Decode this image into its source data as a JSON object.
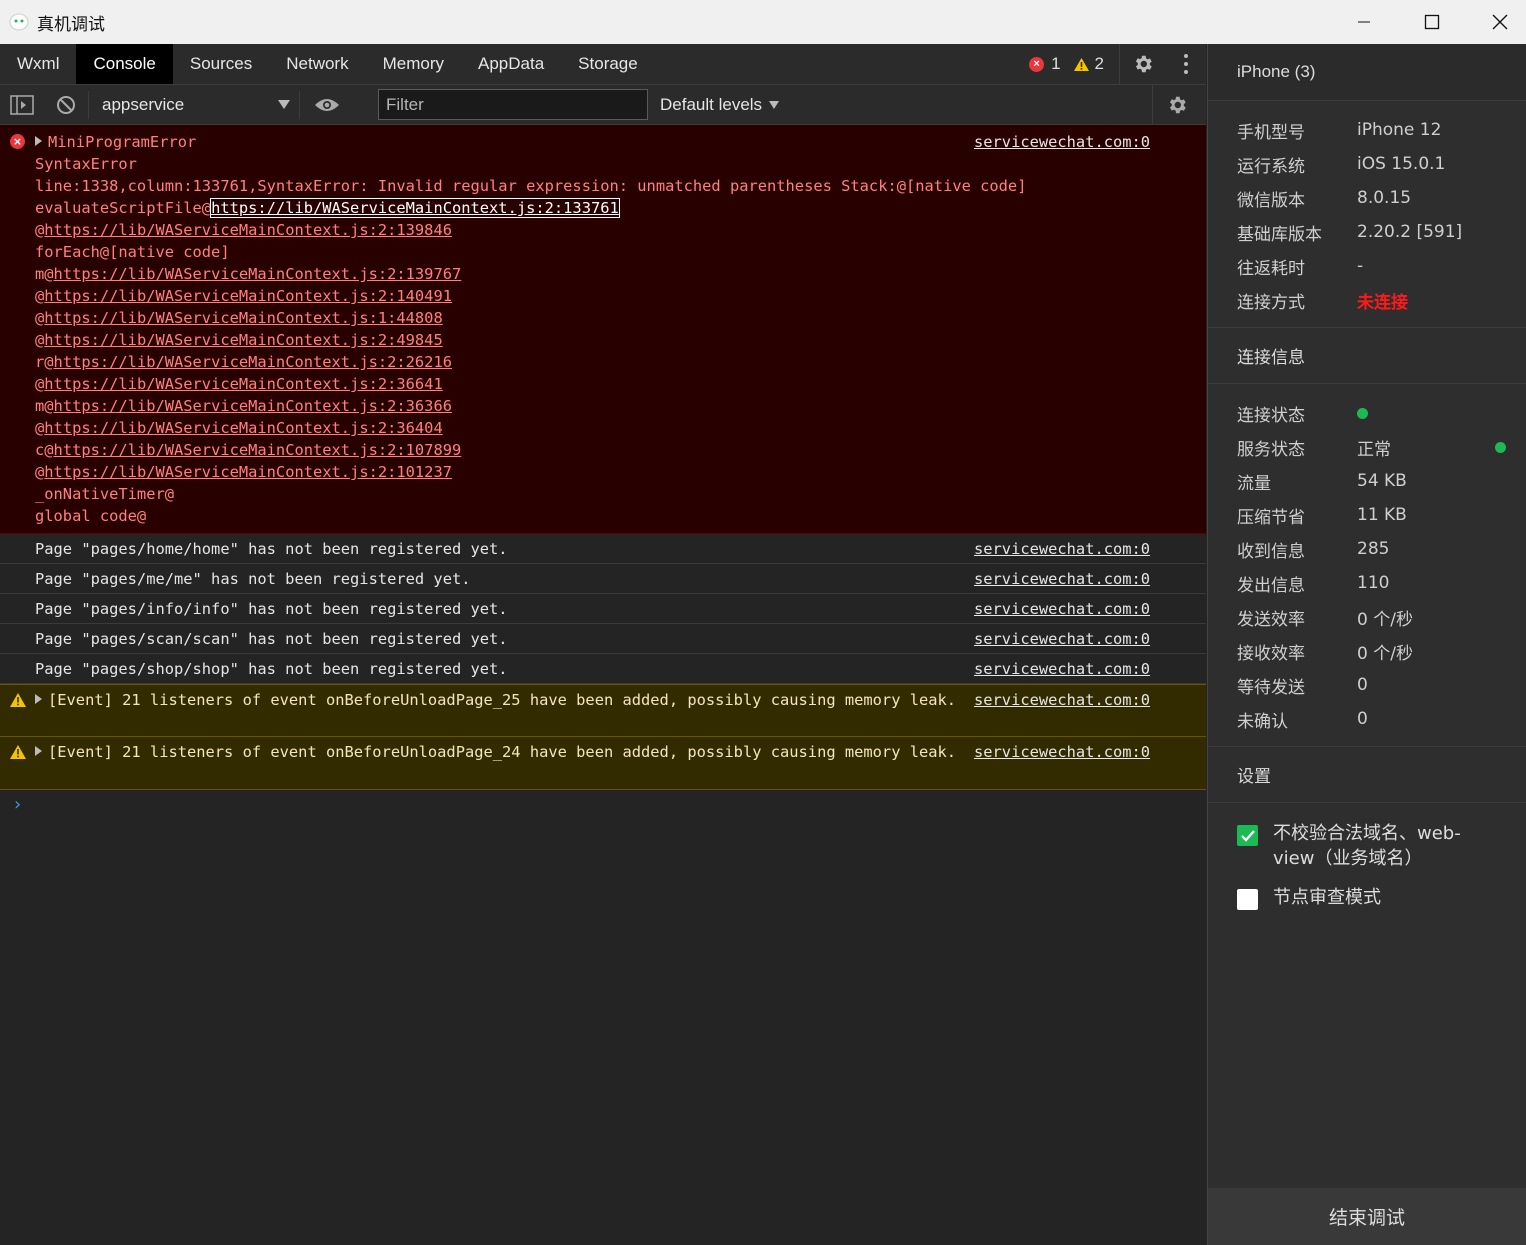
{
  "window": {
    "title": "真机调试",
    "controls": {
      "minimize": "minimize",
      "maximize": "maximize",
      "close": "close"
    }
  },
  "tabs": [
    "Wxml",
    "Console",
    "Sources",
    "Network",
    "Memory",
    "AppData",
    "Storage"
  ],
  "active_tab": "Console",
  "counters": {
    "errors": "1",
    "warnings": "2"
  },
  "toolbar": {
    "context": "appservice",
    "filter_placeholder": "Filter",
    "filter_value": "",
    "levels": "Default levels"
  },
  "console": {
    "error": {
      "title": "MiniProgramError",
      "source": "servicewechat.com:0",
      "line_syntax": "SyntaxError",
      "line_detail": "line:1338,column:133761,SyntaxError: Invalid regular expression: unmatched parentheses Stack:@[native code]",
      "stack": [
        {
          "prefix": "evaluateScriptFile@",
          "link": "https://lib/WAServiceMainContext.js:2:133761"
        },
        {
          "prefix": "@",
          "link": "https://lib/WAServiceMainContext.js:2:139846"
        },
        {
          "prefix": "forEach@[native code]",
          "link": ""
        },
        {
          "prefix": "m@",
          "link": "https://lib/WAServiceMainContext.js:2:139767"
        },
        {
          "prefix": "@",
          "link": "https://lib/WAServiceMainContext.js:2:140491"
        },
        {
          "prefix": "@",
          "link": "https://lib/WAServiceMainContext.js:1:44808"
        },
        {
          "prefix": "@",
          "link": "https://lib/WAServiceMainContext.js:2:49845"
        },
        {
          "prefix": "r@",
          "link": "https://lib/WAServiceMainContext.js:2:26216"
        },
        {
          "prefix": "@",
          "link": "https://lib/WAServiceMainContext.js:2:36641"
        },
        {
          "prefix": "m@",
          "link": "https://lib/WAServiceMainContext.js:2:36366"
        },
        {
          "prefix": "@",
          "link": "https://lib/WAServiceMainContext.js:2:36404"
        },
        {
          "prefix": "c@",
          "link": "https://lib/WAServiceMainContext.js:2:107899"
        },
        {
          "prefix": "@",
          "link": "https://lib/WAServiceMainContext.js:2:101237"
        },
        {
          "prefix": "_onNativeTimer@",
          "link": ""
        },
        {
          "prefix": "global code@",
          "link": ""
        }
      ]
    },
    "logs": [
      {
        "text": "Page \"pages/home/home\" has not been registered yet.",
        "source": "servicewechat.com:0"
      },
      {
        "text": "Page \"pages/me/me\" has not been registered yet.",
        "source": "servicewechat.com:0"
      },
      {
        "text": "Page \"pages/info/info\" has not been registered yet.",
        "source": "servicewechat.com:0"
      },
      {
        "text": "Page \"pages/scan/scan\" has not been registered yet.",
        "source": "servicewechat.com:0"
      },
      {
        "text": "Page \"pages/shop/shop\" has not been registered yet.",
        "source": "servicewechat.com:0"
      }
    ],
    "warnings": [
      {
        "text": "[Event] 21 listeners of event onBeforeUnloadPage_25 have been added, possibly causing memory leak.",
        "source": "servicewechat.com:0"
      },
      {
        "text": "[Event] 21 listeners of event onBeforeUnloadPage_24 have been added, possibly causing memory leak.",
        "source": "servicewechat.com:0"
      }
    ],
    "prompt": "›"
  },
  "device": {
    "name": "iPhone (3)",
    "info": [
      {
        "key": "手机型号",
        "value": "iPhone 12"
      },
      {
        "key": "运行系统",
        "value": "iOS 15.0.1"
      },
      {
        "key": "微信版本",
        "value": "8.0.15"
      },
      {
        "key": "基础库版本",
        "value": "2.20.2 [591]"
      },
      {
        "key": "往返耗时",
        "value": "-"
      },
      {
        "key": "连接方式",
        "value": "未连接"
      }
    ],
    "connection_title": "连接信息",
    "connection": [
      {
        "key": "连接状态",
        "value": ""
      },
      {
        "key": "服务状态",
        "value": "正常"
      },
      {
        "key": "流量",
        "value": "54 KB"
      },
      {
        "key": "压缩节省",
        "value": "11 KB"
      },
      {
        "key": "收到信息",
        "value": "285"
      },
      {
        "key": "发出信息",
        "value": "110"
      },
      {
        "key": "发送效率",
        "value": "0 个/秒"
      },
      {
        "key": "接收效率",
        "value": "0 个/秒"
      },
      {
        "key": "等待发送",
        "value": "0"
      },
      {
        "key": "未确认",
        "value": "0"
      }
    ],
    "settings_title": "设置",
    "settings": [
      {
        "label": "不校验合法域名、web-view（业务域名）",
        "checked": true
      },
      {
        "label": "节点审查模式",
        "checked": false
      }
    ],
    "end_button": "结束调试"
  },
  "colors": {
    "error_bg": "#290000",
    "warn_bg": "#332b00",
    "accent_green": "#1db954",
    "error_red": "#e8383d"
  }
}
